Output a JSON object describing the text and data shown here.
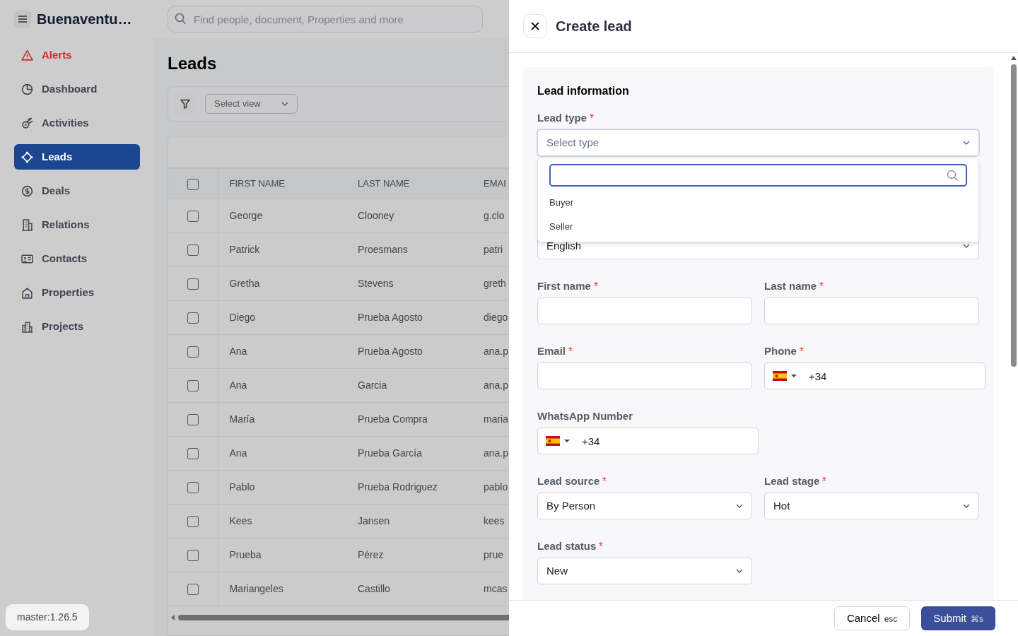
{
  "app": {
    "title": "Buenaventu…"
  },
  "search": {
    "placeholder": "Find people, document, Properties and more"
  },
  "sidebar": {
    "items": [
      {
        "label": "Alerts",
        "kind": "alert",
        "selected": false
      },
      {
        "label": "Dashboard",
        "kind": "link",
        "selected": false
      },
      {
        "label": "Activities",
        "kind": "link",
        "selected": false
      },
      {
        "label": "Leads",
        "kind": "link",
        "selected": true
      },
      {
        "label": "Deals",
        "kind": "link",
        "selected": false
      },
      {
        "label": "Relations",
        "kind": "link",
        "selected": false
      },
      {
        "label": "Contacts",
        "kind": "link",
        "selected": false
      },
      {
        "label": "Properties",
        "kind": "link",
        "selected": false
      },
      {
        "label": "Projects",
        "kind": "link",
        "selected": false
      }
    ]
  },
  "version": "master:1.26.5",
  "page": {
    "title": "Leads",
    "view_select": {
      "placeholder": "Select view"
    }
  },
  "table": {
    "header_checked": false,
    "columns": [
      "FIRST NAME",
      "LAST NAME",
      "EMAI"
    ],
    "rows": [
      {
        "checked": false,
        "cells": [
          "George",
          "Clooney",
          "g.clo"
        ]
      },
      {
        "checked": false,
        "cells": [
          "Patrick",
          "Proesmans",
          "patri"
        ]
      },
      {
        "checked": false,
        "cells": [
          "Gretha",
          "Stevens",
          "greth"
        ]
      },
      {
        "checked": false,
        "cells": [
          "Diego",
          "Prueba Agosto",
          "diego"
        ]
      },
      {
        "checked": false,
        "cells": [
          "Ana",
          "Prueba Agosto",
          "ana.p"
        ]
      },
      {
        "checked": false,
        "cells": [
          "Ana",
          "Garcia",
          "ana.p"
        ]
      },
      {
        "checked": false,
        "cells": [
          "María",
          "Prueba Compra",
          "maria"
        ]
      },
      {
        "checked": false,
        "cells": [
          "Ana",
          "Prueba García",
          "ana.p"
        ]
      },
      {
        "checked": false,
        "cells": [
          "Pablo",
          "Prueba Rodriguez",
          "pablo"
        ]
      },
      {
        "checked": false,
        "cells": [
          "Kees",
          "Jansen",
          "kees"
        ]
      },
      {
        "checked": false,
        "cells": [
          "Prueba",
          "Pérez",
          "prue"
        ]
      },
      {
        "checked": false,
        "cells": [
          "Mariangeles",
          "Castillo",
          "mcas"
        ]
      }
    ]
  },
  "drawer": {
    "title": "Create lead",
    "section": "Lead information",
    "rows": [
      [
        {
          "kind": "select",
          "label": "Lead type",
          "required": true,
          "placeholder": "Select type",
          "expanded": true,
          "options": [
            "Buyer",
            "Seller"
          ]
        }
      ],
      [
        {
          "kind": "select",
          "value": "English",
          "expanded": false
        }
      ],
      [
        {
          "kind": "text",
          "label": "First name",
          "required": true
        },
        {
          "kind": "text",
          "label": "Last name",
          "required": true
        }
      ],
      [
        {
          "kind": "text",
          "label": "Email",
          "required": true
        },
        {
          "kind": "phone",
          "label": "Phone",
          "required": true,
          "value": "+34"
        }
      ],
      [
        {
          "kind": "phone",
          "label": "WhatsApp Number",
          "required": false,
          "value": "+34"
        }
      ],
      [
        {
          "kind": "select",
          "label": "Lead source",
          "required": true,
          "value": "By Person",
          "expanded": false
        },
        {
          "kind": "select",
          "label": "Lead stage",
          "required": true,
          "value": "Hot",
          "expanded": false
        }
      ],
      [
        {
          "kind": "select",
          "label": "Lead status",
          "required": true,
          "value": "New",
          "expanded": false
        }
      ]
    ],
    "cancel": {
      "label": "Cancel",
      "shortcut": "esc"
    },
    "submit": {
      "label": "Submit",
      "shortcut": "⌘s"
    }
  }
}
